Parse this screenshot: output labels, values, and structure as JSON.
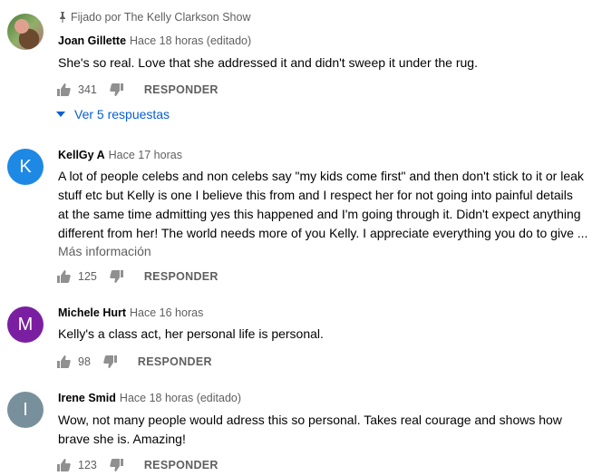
{
  "comments": [
    {
      "pinned_label": "Fijado por The Kelly Clarkson Show",
      "avatar_letter": "",
      "avatar_color": "",
      "author": "Joan Gillette",
      "time": "Hace 18 horas (editado)",
      "lines": [
        "She's so real. Love that she addressed it and didn't sweep it under the rug."
      ],
      "more_label": "",
      "likes": "341",
      "reply_label": "RESPONDER",
      "view_replies": "Ver 5 respuestas"
    },
    {
      "avatar_letter": "K",
      "avatar_color": "#1e88e5",
      "author": "KellGy A",
      "time": "Hace 17 horas",
      "lines": [
        "A lot of people celebs and non celebs say \"my kids come first\" and then don't stick to it or leak",
        "stuff etc but Kelly is one I believe this from and I respect her for not going into painful details",
        "at the same time admitting yes this happened and I'm going through it. Didn't expect anything",
        "different from her! The world needs more of you Kelly. I appreciate everything you do to give ..."
      ],
      "more_label": "Más información",
      "likes": "125",
      "reply_label": "RESPONDER"
    },
    {
      "avatar_letter": "M",
      "avatar_color": "#7b1fa2",
      "author": "Michele Hurt",
      "time": "Hace 16 horas",
      "lines": [
        "Kelly's a class act, her personal life is personal."
      ],
      "more_label": "",
      "likes": "98",
      "reply_label": "RESPONDER"
    },
    {
      "avatar_letter": "I",
      "avatar_color": "#78909c",
      "author": "Irene Smid",
      "time": "Hace 18 horas (editado)",
      "lines": [
        "Wow, not many people would adress this so personal. Takes real courage and shows how",
        "brave she is. Amazing!"
      ],
      "more_label": "",
      "likes": "123",
      "reply_label": "RESPONDER"
    }
  ],
  "colors": {
    "link": "#065fd4",
    "secondary": "#606060",
    "text": "#030303"
  },
  "icons": [
    "pin-icon",
    "thumb-up-icon",
    "thumb-down-icon",
    "caret-down-icon"
  ]
}
